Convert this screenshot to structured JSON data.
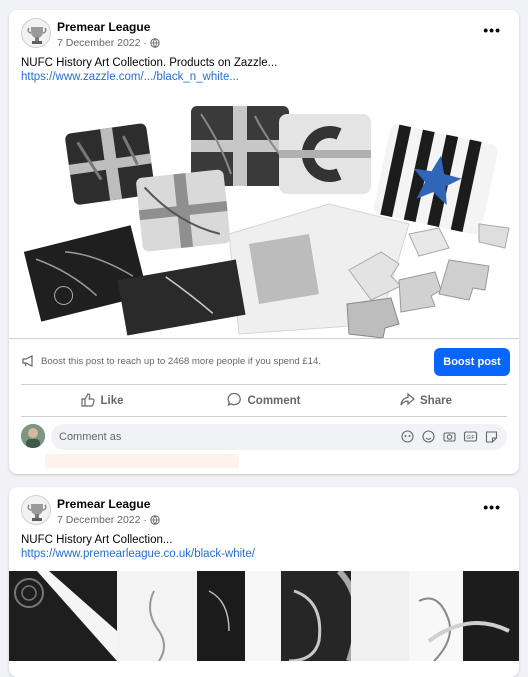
{
  "posts": [
    {
      "page_name": "Premear League",
      "date": "7 December 2022 ·",
      "text": "NUFC History Art Collection. Products on Zazzle...",
      "link": "https://www.zazzle.com/.../black_n_white...",
      "boost_text": "Boost this post to reach up to 2468 more people if you spend £14.",
      "boost_button": "Boost post",
      "actions": {
        "like": "Like",
        "comment": "Comment",
        "share": "Share"
      },
      "comment_placeholder": "Comment as"
    },
    {
      "page_name": "Premear League",
      "date": "7 December 2022 ·",
      "text": "NUFC History Art Collection...",
      "link": "https://www.premearleague.co.uk/black-white/"
    }
  ],
  "icons": [
    "globe-icon",
    "more-icon",
    "megaphone-icon",
    "like-icon",
    "comment-icon",
    "share-icon",
    "avatar-icon",
    "emoji-icon",
    "camera-icon",
    "gif-icon",
    "sticker-icon"
  ],
  "colors": {
    "link": "#216fdb",
    "primary_button": "#0866ff",
    "muted_text": "#65676b"
  }
}
